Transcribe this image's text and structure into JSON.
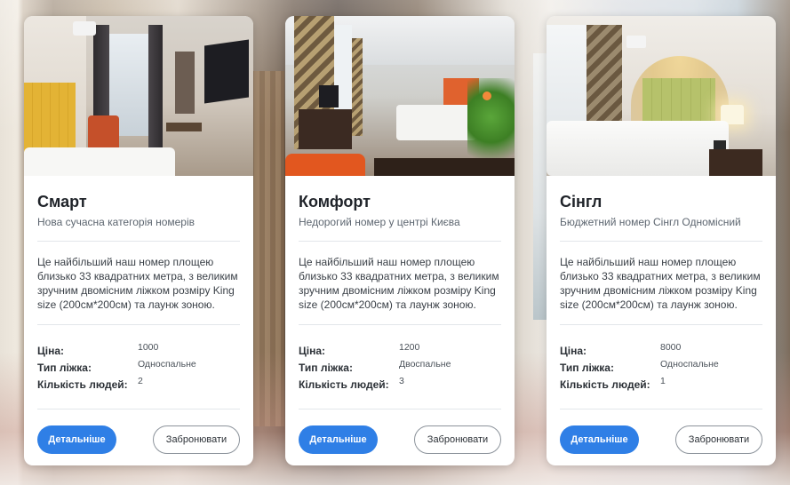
{
  "labels": {
    "price": "Ціна:",
    "bed_type": "Тип ліжка:",
    "people": "Кількість людей:",
    "details_button": "Детальніше",
    "book_button": "Забронювати"
  },
  "rooms": [
    {
      "title": "Смарт",
      "subtitle": "Нова сучасна категорія номерів",
      "description": "Це найбільший наш номер площею близько 33 квадратних метра, з великим зручним двомісним ліжком розміру King size (200см*200см) та лаунж зоною.",
      "price": "1000",
      "bed_type": "Односпальне",
      "people": "2"
    },
    {
      "title": "Комфорт",
      "subtitle": "Недорогий номер у центрі Києва",
      "description": "Це найбільший наш номер площею близько 33 квадратних метра, з великим зручним двомісним ліжком розміру King size (200см*200см) та лаунж зоною.",
      "price": "1200",
      "bed_type": "Двоспальне",
      "people": "3"
    },
    {
      "title": "Сінгл",
      "subtitle": "Бюджетний номер Сінгл Одномісний",
      "description": "Це найбільший наш номер площею близько 33 квадратних метра, з великим зручним двомісним ліжком розміру King size (200см*200см) та лаунж зоною.",
      "price": "8000",
      "bed_type": "Односпальне",
      "people": "1"
    }
  ],
  "colors": {
    "primary_button": "#2f7fe6",
    "card_background": "#ffffff",
    "title_text": "#1f2329"
  }
}
